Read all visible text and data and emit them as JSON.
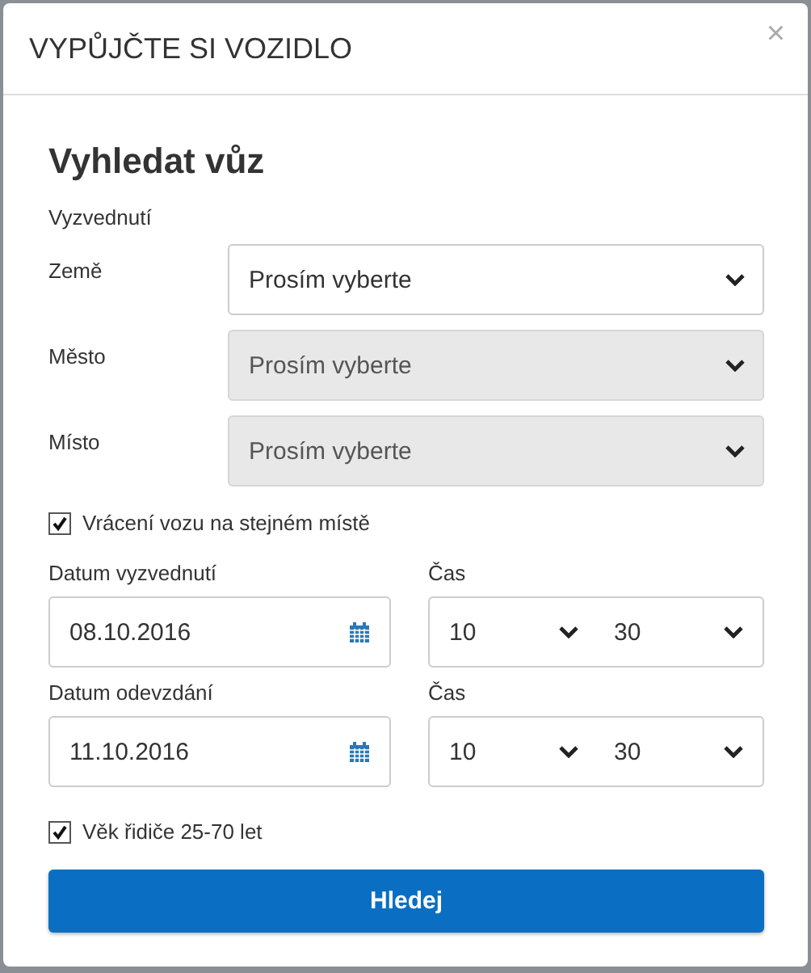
{
  "modal": {
    "title": "VYPŮJČTE SI VOZIDLO",
    "close": "×"
  },
  "heading": "Vyhledat vůz",
  "section_label": "Vyzvednutí",
  "selects": [
    {
      "label": "Země",
      "value": "Prosím vyberte",
      "disabled": false
    },
    {
      "label": "Město",
      "value": "Prosím vyberte",
      "disabled": true
    },
    {
      "label": "Místo",
      "value": "Prosím vyberte",
      "disabled": true
    }
  ],
  "same_place": {
    "label": "Vrácení vozu na stejném místě",
    "checked": true
  },
  "dates": [
    {
      "label": "Datum vyzvednutí",
      "value": "08.10.2016",
      "time_label": "Čas",
      "hour": "10",
      "minute": "30"
    },
    {
      "label": "Datum odevzdání",
      "value": "11.10.2016",
      "time_label": "Čas",
      "hour": "10",
      "minute": "30"
    }
  ],
  "age": {
    "label": "Věk řidiče 25-70 let",
    "checked": true
  },
  "search_button": "Hledej"
}
